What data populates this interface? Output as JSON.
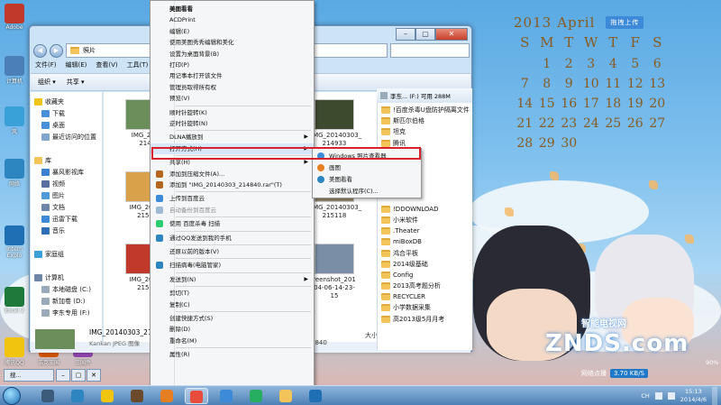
{
  "desktop": {
    "icons": [
      {
        "label": "Adobe",
        "color": "#c0392b"
      },
      {
        "label": "计算机",
        "color": "#4a7fb8"
      },
      {
        "label": "风",
        "color": "#3aa0d8"
      },
      {
        "label": "网络",
        "color": "#2e86c1"
      },
      {
        "label": "Intern Explo",
        "color": "#1f6fb5"
      },
      {
        "label": "Excel 2",
        "color": "#1e7a3a"
      },
      {
        "label": "腾讯QQ",
        "color": "#f1c40f"
      },
      {
        "label": "浩克王国",
        "color": "#d35400"
      },
      {
        "label": "三国杀",
        "color": "#8e44ad"
      }
    ]
  },
  "calendar": {
    "year": "2013",
    "month": "April",
    "upload_label": "拖拽上传",
    "weekdays": [
      "S",
      "M",
      "T",
      "W",
      "T",
      "F",
      "S"
    ],
    "days": [
      "1",
      "2",
      "3",
      "4",
      "5",
      "6",
      "7",
      "8",
      "9",
      "10",
      "11",
      "12",
      "13",
      "14",
      "15",
      "16",
      "17",
      "18",
      "19",
      "20",
      "21",
      "22",
      "23",
      "24",
      "25",
      "26",
      "27",
      "28",
      "29",
      "30"
    ]
  },
  "explorer": {
    "address": "照片",
    "menu": [
      "文件(F)",
      "编辑(E)",
      "查看(V)",
      "工具(T)"
    ],
    "toolbar": [
      "组织 ▾",
      "共享 ▾"
    ],
    "nav": [
      {
        "label": "收藏夹",
        "color": "#f0c419"
      },
      {
        "label": "下载",
        "color": "#4a90d9"
      },
      {
        "label": "桌面",
        "color": "#4a90d9"
      },
      {
        "label": "最近访问的位置",
        "color": "#7fa7cf"
      },
      {
        "label": "",
        "color": ""
      },
      {
        "label": "库",
        "color": "#f2c45a"
      },
      {
        "label": "暴风影视库",
        "color": "#3a7fd0"
      },
      {
        "label": "视频",
        "color": "#5a6fa0"
      },
      {
        "label": "图片",
        "color": "#4f9bd9"
      },
      {
        "label": "文档",
        "color": "#6f86a8"
      },
      {
        "label": "迅雷下载",
        "color": "#3c8ad8"
      },
      {
        "label": "音乐",
        "color": "#2e6fb3"
      },
      {
        "label": "",
        "color": ""
      },
      {
        "label": "家庭组",
        "color": "#3aa0d8"
      },
      {
        "label": "",
        "color": ""
      },
      {
        "label": "计算机",
        "color": "#6f86a8"
      },
      {
        "label": "本地磁盘 (C:)",
        "color": "#9ab"
      },
      {
        "label": "新加卷 (D:)",
        "color": "#9ab"
      },
      {
        "label": "李东专用 (F:)",
        "color": "#9ab"
      }
    ],
    "thumbs": [
      {
        "label": "IMG_201\n214",
        "color": "#6a8f5a"
      },
      {
        "label": "IMG_20140303_\n214933",
        "color": "#3e4a2e"
      },
      {
        "label": "IMG_2014\n2150",
        "color": "#d9a24a"
      },
      {
        "label": "IMG_20140303_\n215118",
        "color": "#9b8d6a"
      },
      {
        "label": "IMG_2014\n2152",
        "color": "#c0392b"
      },
      {
        "label": "reenshot_201\n04-06-14-23-\n15",
        "color": "#7a8fa6"
      }
    ],
    "selected_file": "IMG_20140303_214840",
    "selected_type": "Kankan JPEG 图像",
    "size_label": "大小: 2.62 MB",
    "bottom_num": "1840"
  },
  "folder_panel": {
    "header": "李东... (F:) 可用 288M",
    "items": [
      "!百度杀毒U盘防护隔离文件",
      "斯匹尔伯格",
      "坦克",
      "腾讯",
      "",
      "",
      "",
      "isk",
      "",
      "!DDOWNLOAD",
      "小米软件",
      ".Theater",
      "miBoxDB",
      "鸿合平板",
      "2014级基础",
      "Config",
      "2013高考题分析",
      "RECYCLER",
      "小学数据采集",
      "高2013级5月月考"
    ]
  },
  "context_menu": {
    "items": [
      {
        "label": "美图看看",
        "bold": true,
        "icon": "",
        "arrow": false,
        "sep_after": false
      },
      {
        "label": "ACDPrint",
        "icon": "",
        "arrow": false
      },
      {
        "label": "编辑(E)",
        "icon": "",
        "arrow": false
      },
      {
        "label": "使用美图秀秀编辑和美化",
        "icon": "",
        "arrow": false
      },
      {
        "label": "设置为桌面背景(B)",
        "icon": "",
        "arrow": false
      },
      {
        "label": "打印(P)",
        "icon": "",
        "arrow": false
      },
      {
        "label": "用记事本打开该文件",
        "icon": "",
        "arrow": false
      },
      {
        "label": "管理员取得所有权",
        "icon": "",
        "arrow": false
      },
      {
        "label": "预览(V)",
        "icon": "",
        "arrow": false,
        "sep_after": true
      },
      {
        "label": "顺时针旋转(K)",
        "icon": "",
        "arrow": false
      },
      {
        "label": "逆时针旋转(N)",
        "icon": "",
        "arrow": false,
        "sep_after": true
      },
      {
        "label": "DLNA播放到",
        "icon": "",
        "arrow": true
      },
      {
        "label": "打开方式(H)",
        "icon": "",
        "arrow": true,
        "hl": true,
        "sep_after": true
      },
      {
        "label": "共享(H)",
        "icon": "",
        "arrow": true
      },
      {
        "label": "添加到压缩文件(A)...",
        "icon": "#b5651d",
        "arrow": false
      },
      {
        "label": "添加到 \"IMG_20140303_214840.rar\"(T)",
        "icon": "#b5651d",
        "arrow": false,
        "sep_after": true
      },
      {
        "label": "上传到百度云",
        "icon": "#3c8ad8",
        "arrow": false
      },
      {
        "label": "自动备份到百度云",
        "icon": "#9fb8d6",
        "arrow": false,
        "dis": true,
        "sep_after": true
      },
      {
        "label": "使用 百度杀毒 扫描",
        "icon": "#2ecc71",
        "arrow": false,
        "sep_after": true
      },
      {
        "label": "通过QQ发送到我的手机",
        "icon": "#2e86c1",
        "arrow": false,
        "sep_after": true
      },
      {
        "label": "还原以前的版本(V)",
        "icon": "",
        "arrow": false,
        "sep_after": true
      },
      {
        "label": "扫描病毒(电脑管家)",
        "icon": "#2e86c1",
        "arrow": false,
        "sep_after": true
      },
      {
        "label": "发送到(N)",
        "icon": "",
        "arrow": true,
        "sep_after": true
      },
      {
        "label": "剪切(T)",
        "icon": "",
        "arrow": false
      },
      {
        "label": "复制(C)",
        "icon": "",
        "arrow": false,
        "sep_after": true
      },
      {
        "label": "创建快捷方式(S)",
        "icon": "",
        "arrow": false
      },
      {
        "label": "删除(D)",
        "icon": "",
        "arrow": false
      },
      {
        "label": "重命名(M)",
        "icon": "",
        "arrow": false,
        "sep_after": true
      },
      {
        "label": "属性(R)",
        "icon": "",
        "arrow": false
      }
    ]
  },
  "submenu": {
    "items": [
      {
        "label": "Windows 照片查看器",
        "icon": "#3c8ad8"
      },
      {
        "label": "画图",
        "icon": "#e67e22"
      },
      {
        "label": "美图看看",
        "icon": "#2e86c1"
      },
      {
        "label": "选择默认程序(C)...",
        "icon": ""
      }
    ]
  },
  "watermark": {
    "logo": "ZNDS.com",
    "cn": "智能电视网",
    "speed_label": "网络点播",
    "speed_value": "3.70 KB/S"
  },
  "lower_tab": "搜...",
  "taskbar": {
    "icons": [
      {
        "name": "start"
      },
      {
        "name": "cmd-icon",
        "color": "#3c5a7a"
      },
      {
        "name": "speedtest-icon",
        "color": "#2e86c1"
      },
      {
        "name": "ie-icon",
        "color": "#f1c40f"
      },
      {
        "name": "monster-icon",
        "color": "#6a4a2a"
      },
      {
        "name": "firefox-icon",
        "color": "#e67e22"
      },
      {
        "name": "meitu-icon",
        "color": "#e74c3c",
        "active": true
      },
      {
        "name": "cloud-icon",
        "color": "#3c8ad8"
      },
      {
        "name": "tool-icon",
        "color": "#27ae60"
      },
      {
        "name": "folder-icon",
        "color": "#f2c45a"
      },
      {
        "name": "win-icon",
        "color": "#1f6fb5"
      }
    ],
    "ime": "CH",
    "time": "15:13",
    "date": "2014/4/6"
  },
  "misc": {
    "percent": "90%"
  }
}
